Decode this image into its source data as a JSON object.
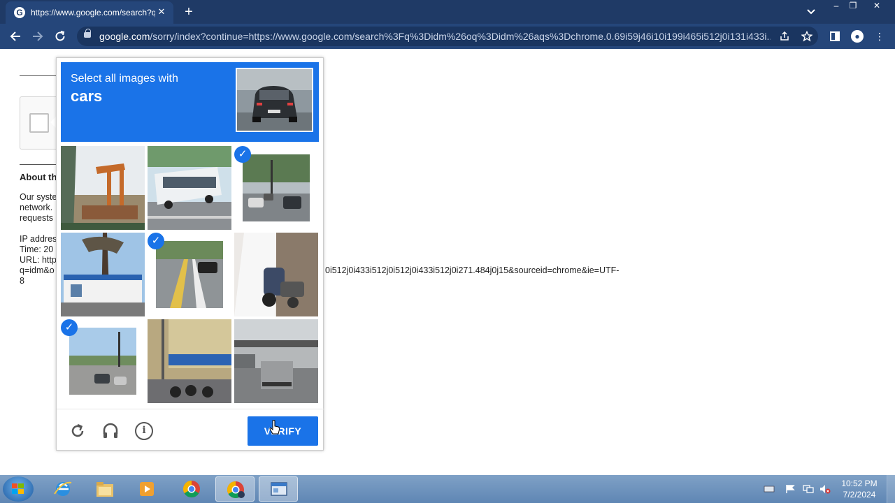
{
  "browser": {
    "tab_title": "https://www.google.com/search?q=idm",
    "tab_favicon": "G",
    "new_tab": "+",
    "tab_search_icon": "chevron-down-icon",
    "window_controls": [
      "–",
      "❐",
      "✕"
    ],
    "url_host": "google.com",
    "url_rest": "/sorry/index?continue=https://www.google.com/search%3Fq%3Didm%26oq%3Didm%26aqs%3Dchrome.0.69i59j46i10i199i465i512j0i131i433i..."
  },
  "page": {
    "about_heading": "About th",
    "lines": [
      "Our syste",
      "network.",
      "requests",
      "",
      "IP addres",
      "Time: 20",
      "URL: http"
    ],
    "url_line": "q=idm&o",
    "url_line_tail": "0i512j0i433i512j0i512j0i433i512j0i271.484j0j15&sourceid=chrome&ie=UTF-",
    "url_line_end": "8"
  },
  "captcha": {
    "prompt_line1": "Select all images with",
    "prompt_line2": "cars",
    "tiles": [
      {
        "name": "tile-1",
        "selected": false,
        "scene": "crane"
      },
      {
        "name": "tile-2",
        "selected": false,
        "scene": "bus"
      },
      {
        "name": "tile-3",
        "selected": true,
        "scene": "street-cars"
      },
      {
        "name": "tile-4",
        "selected": false,
        "scene": "gas-station"
      },
      {
        "name": "tile-5",
        "selected": true,
        "scene": "road-car"
      },
      {
        "name": "tile-6",
        "selected": false,
        "scene": "scooter"
      },
      {
        "name": "tile-7",
        "selected": true,
        "scene": "intersection"
      },
      {
        "name": "tile-8",
        "selected": false,
        "scene": "motorbikes"
      },
      {
        "name": "tile-9",
        "selected": false,
        "scene": "truck"
      }
    ],
    "verify_label": "VERIFY",
    "check_glyph": "✓",
    "reload_glyph": "↻",
    "audio_glyph": "🎧",
    "info_glyph": "i"
  },
  "taskbar": {
    "time": "10:52 PM",
    "date": "7/2/2024"
  },
  "colors": {
    "chrome_dark": "#1f3a66",
    "chrome_toolbar": "#25467a",
    "recaptcha_blue": "#1a73e8"
  }
}
